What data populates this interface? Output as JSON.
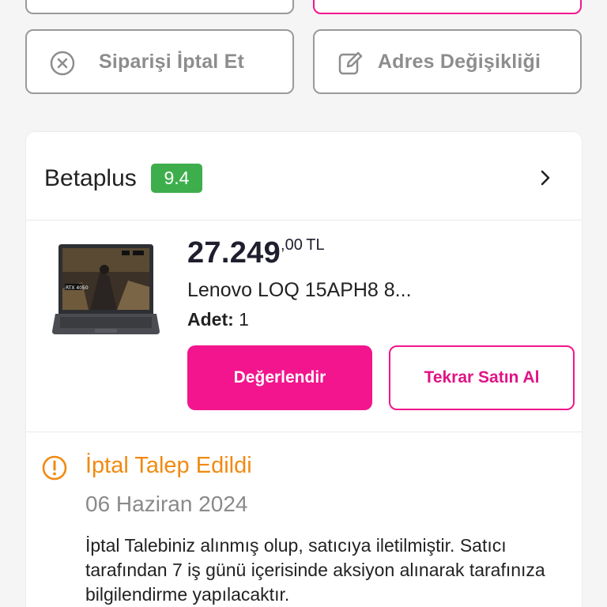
{
  "actions": {
    "cancel_label": "Siparişi İptal Et",
    "address_label": "Adres Değişikliği"
  },
  "seller": {
    "name": "Betaplus",
    "score": "9.4"
  },
  "product": {
    "price_main": "27.249",
    "price_decimals": ",00",
    "currency": "TL",
    "name": "Lenovo LOQ 15APH8 8...",
    "quantity_label": "Adet:",
    "quantity": "1",
    "rate_button": "Değerlendir",
    "rebuy_button": "Tekrar Satın Al",
    "image_badge": "RTX 4050"
  },
  "status": {
    "title": "İptal Talep Edildi",
    "date": "06 Haziran 2024",
    "message": "İptal Talebiniz alınmış olup, satıcıya iletilmiştir. Satıcı tarafından 7 iş günü içerisinde aksiyon alınarak tarafınıza bilgilendirme yapılacaktır."
  },
  "colors": {
    "brand_pink": "#f2158e",
    "score_green": "#3eae4d",
    "status_orange": "#f08a12"
  },
  "icons": [
    "close-circle-icon",
    "edit-icon",
    "chevron-right-icon",
    "warning-circle-icon"
  ]
}
